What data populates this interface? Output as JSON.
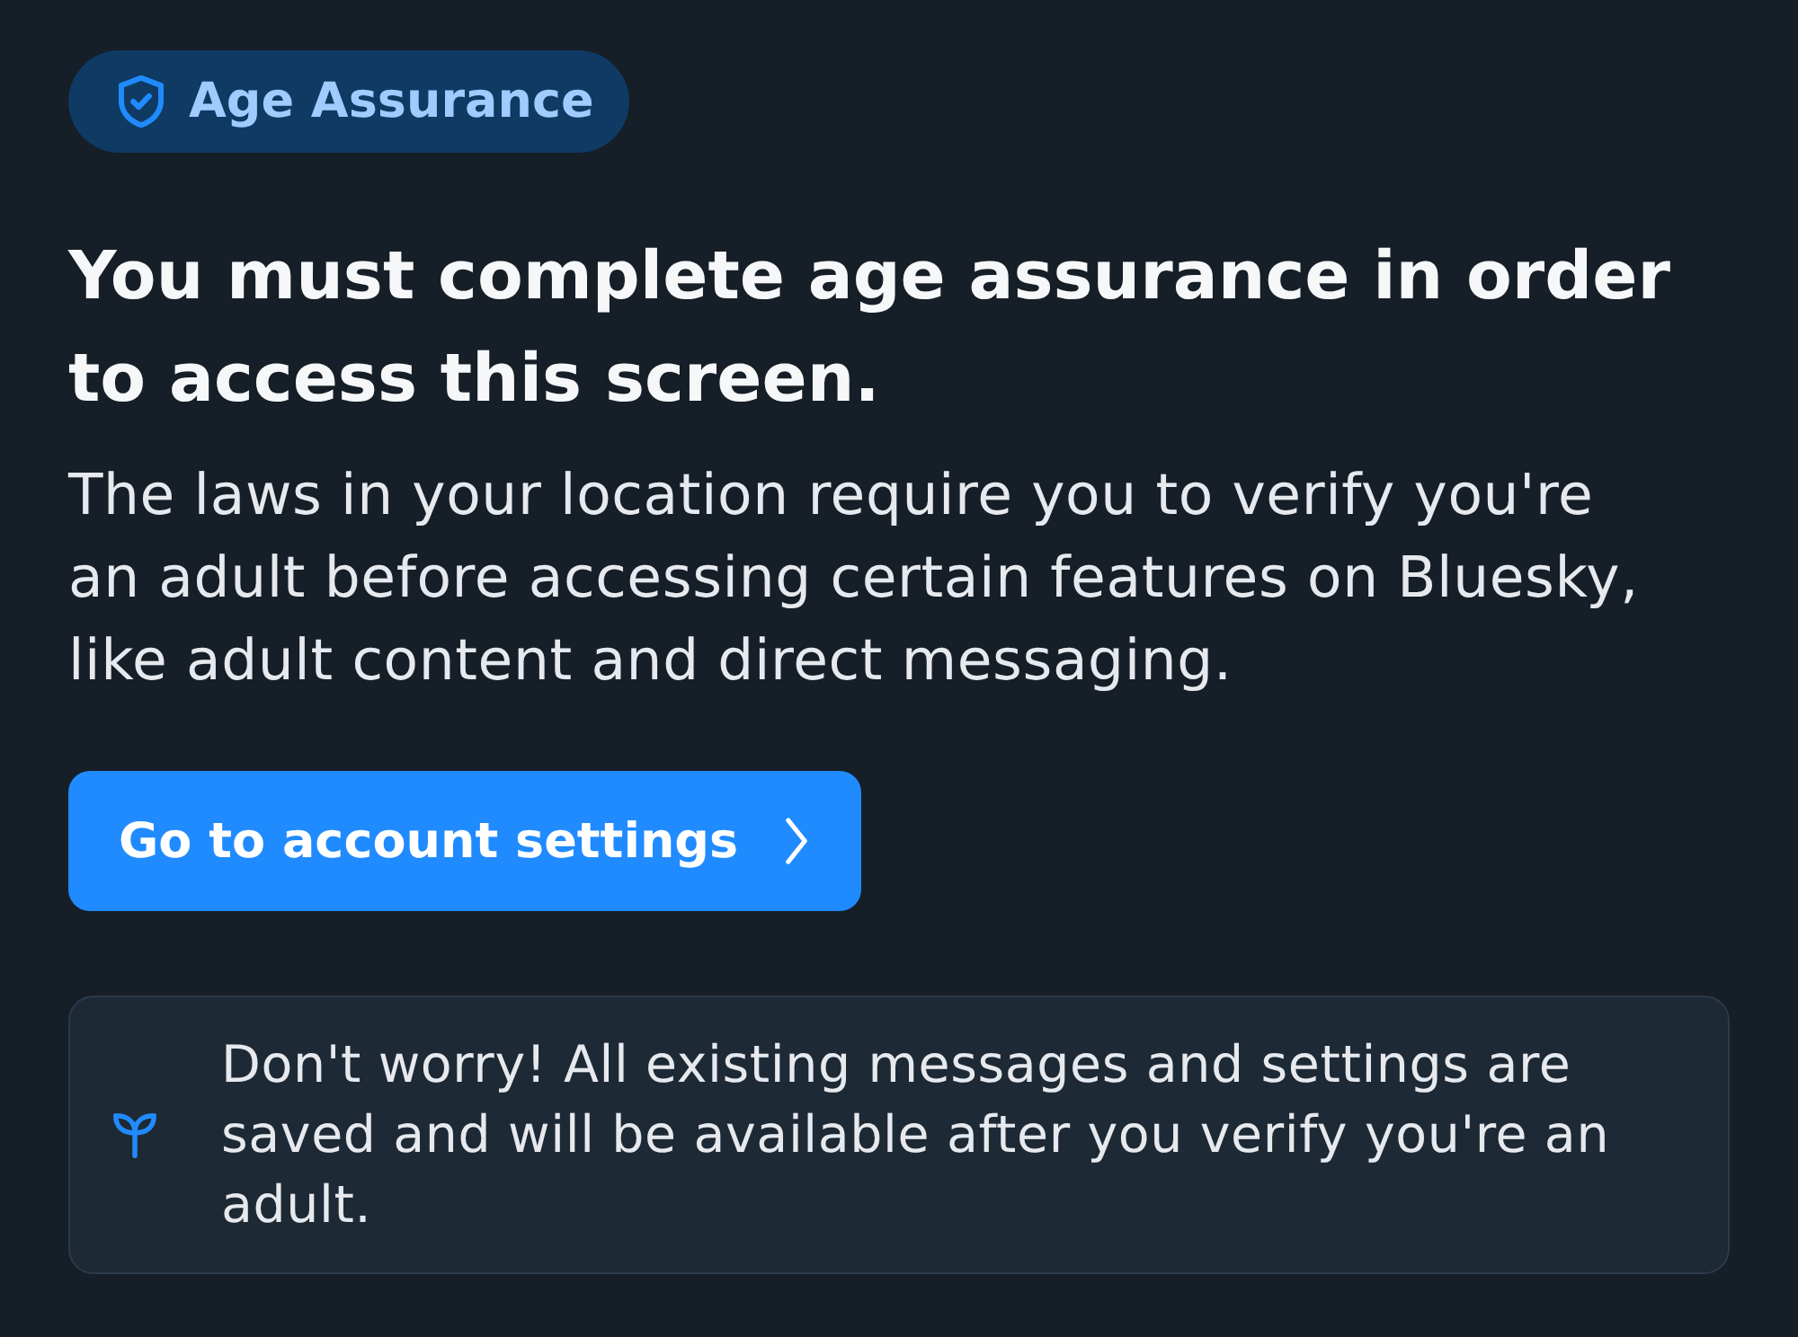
{
  "badge": {
    "label": "Age Assurance"
  },
  "heading": "You must complete age assurance in order to access this screen.",
  "description": "The laws in your location require you to verify you're an adult before accessing certain features on Bluesky, like adult content and direct messaging.",
  "button": {
    "label": "Go to account settings"
  },
  "notice": {
    "text": "Don't worry! All existing messages and settings are saved and will be available after you verify you're an adult."
  }
}
